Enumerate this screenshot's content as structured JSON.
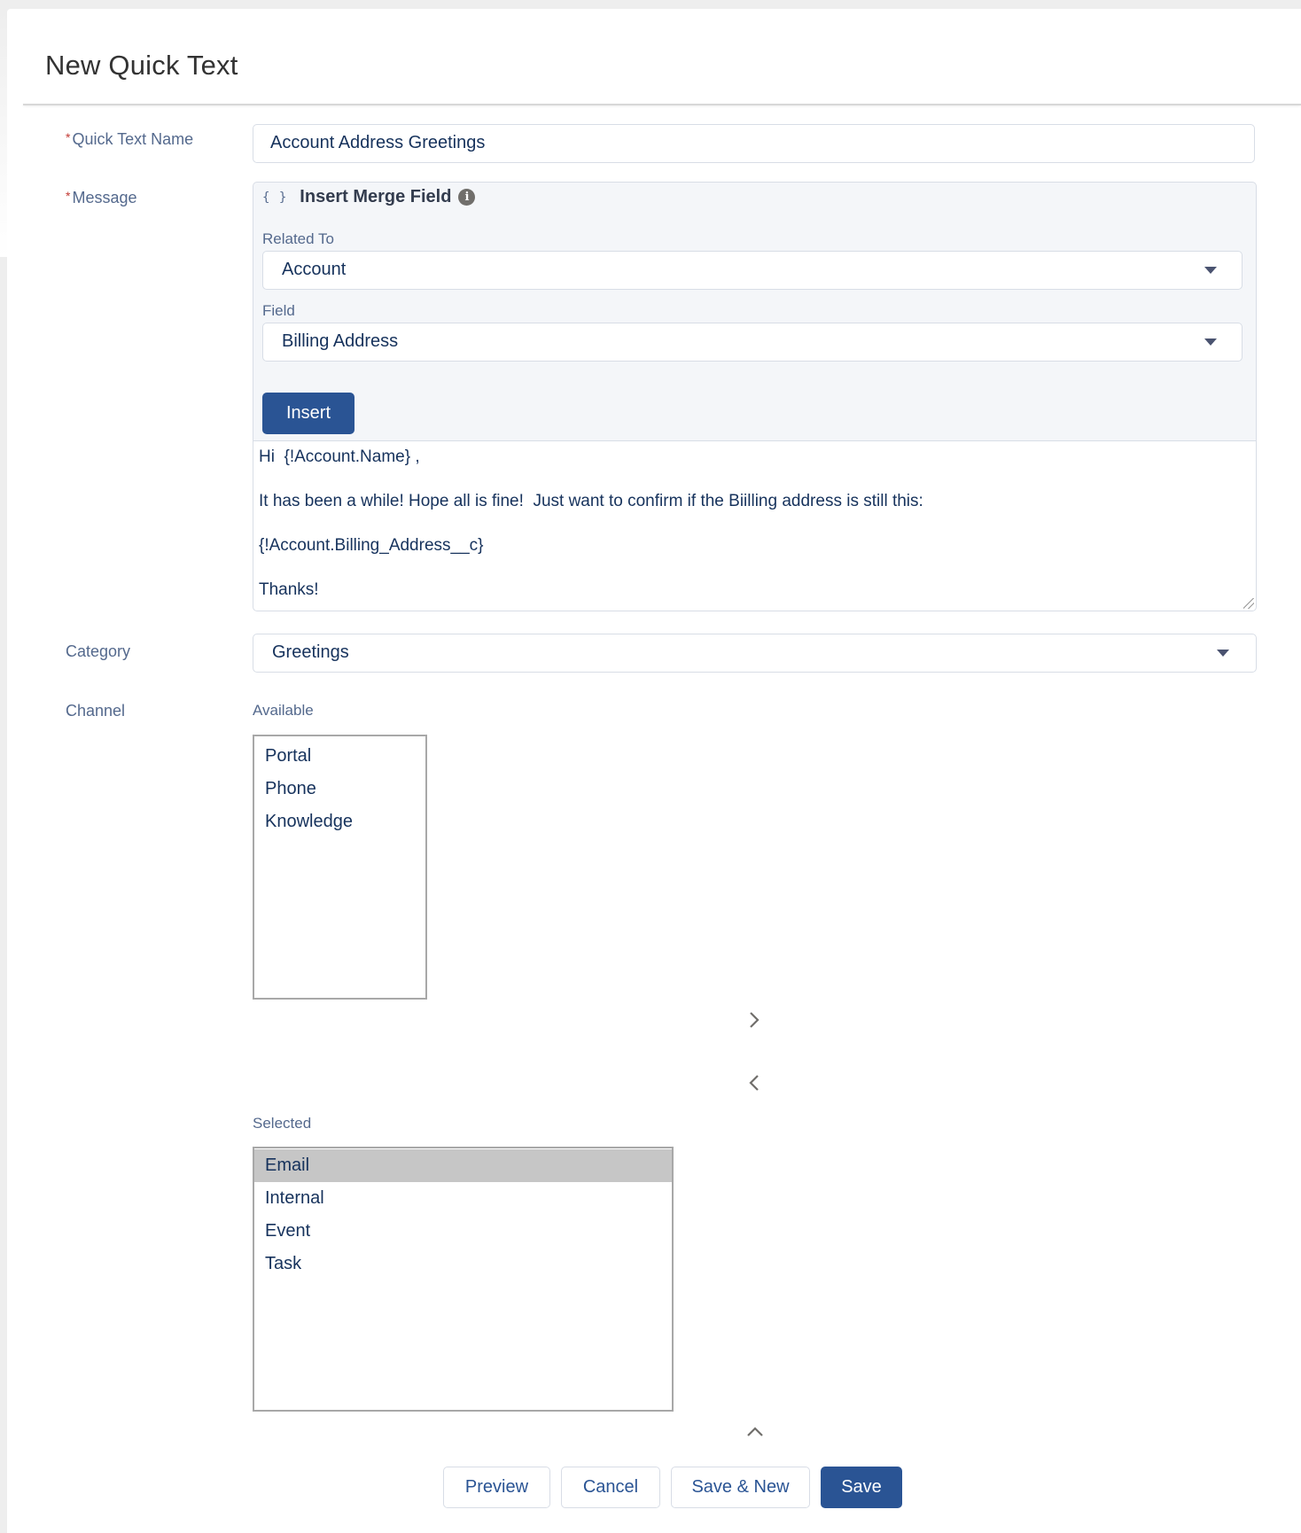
{
  "header": {
    "title": "New Quick Text"
  },
  "form": {
    "name": {
      "label": "Quick Text Name",
      "required": true,
      "value": "Account Address Greetings"
    },
    "message": {
      "label": "Message",
      "required": true,
      "merge_field": {
        "title": "Insert Merge Field",
        "braces_icon": "{ }",
        "info_icon": "i",
        "related_to": {
          "label": "Related To",
          "value": "Account"
        },
        "field": {
          "label": "Field",
          "value": "Billing Address"
        },
        "insert_label": "Insert"
      },
      "body_lines": [
        "Hi  {!Account.Name} ,",
        "It has been a while! Hope all is fine!  Just want to confirm if the Biilling address is still this:",
        "{!Account.Billing_Address__c}",
        "Thanks!"
      ]
    },
    "category": {
      "label": "Category",
      "value": "Greetings"
    },
    "channel": {
      "label": "Channel",
      "available_label": "Available",
      "available": [
        "Portal",
        "Phone",
        "Knowledge"
      ],
      "selected_label": "Selected",
      "selected": [
        "Email",
        "Internal",
        "Event",
        "Task"
      ],
      "highlighted": "Email"
    }
  },
  "footer": {
    "preview": "Preview",
    "cancel": "Cancel",
    "save_new": "Save & New",
    "save": "Save"
  }
}
